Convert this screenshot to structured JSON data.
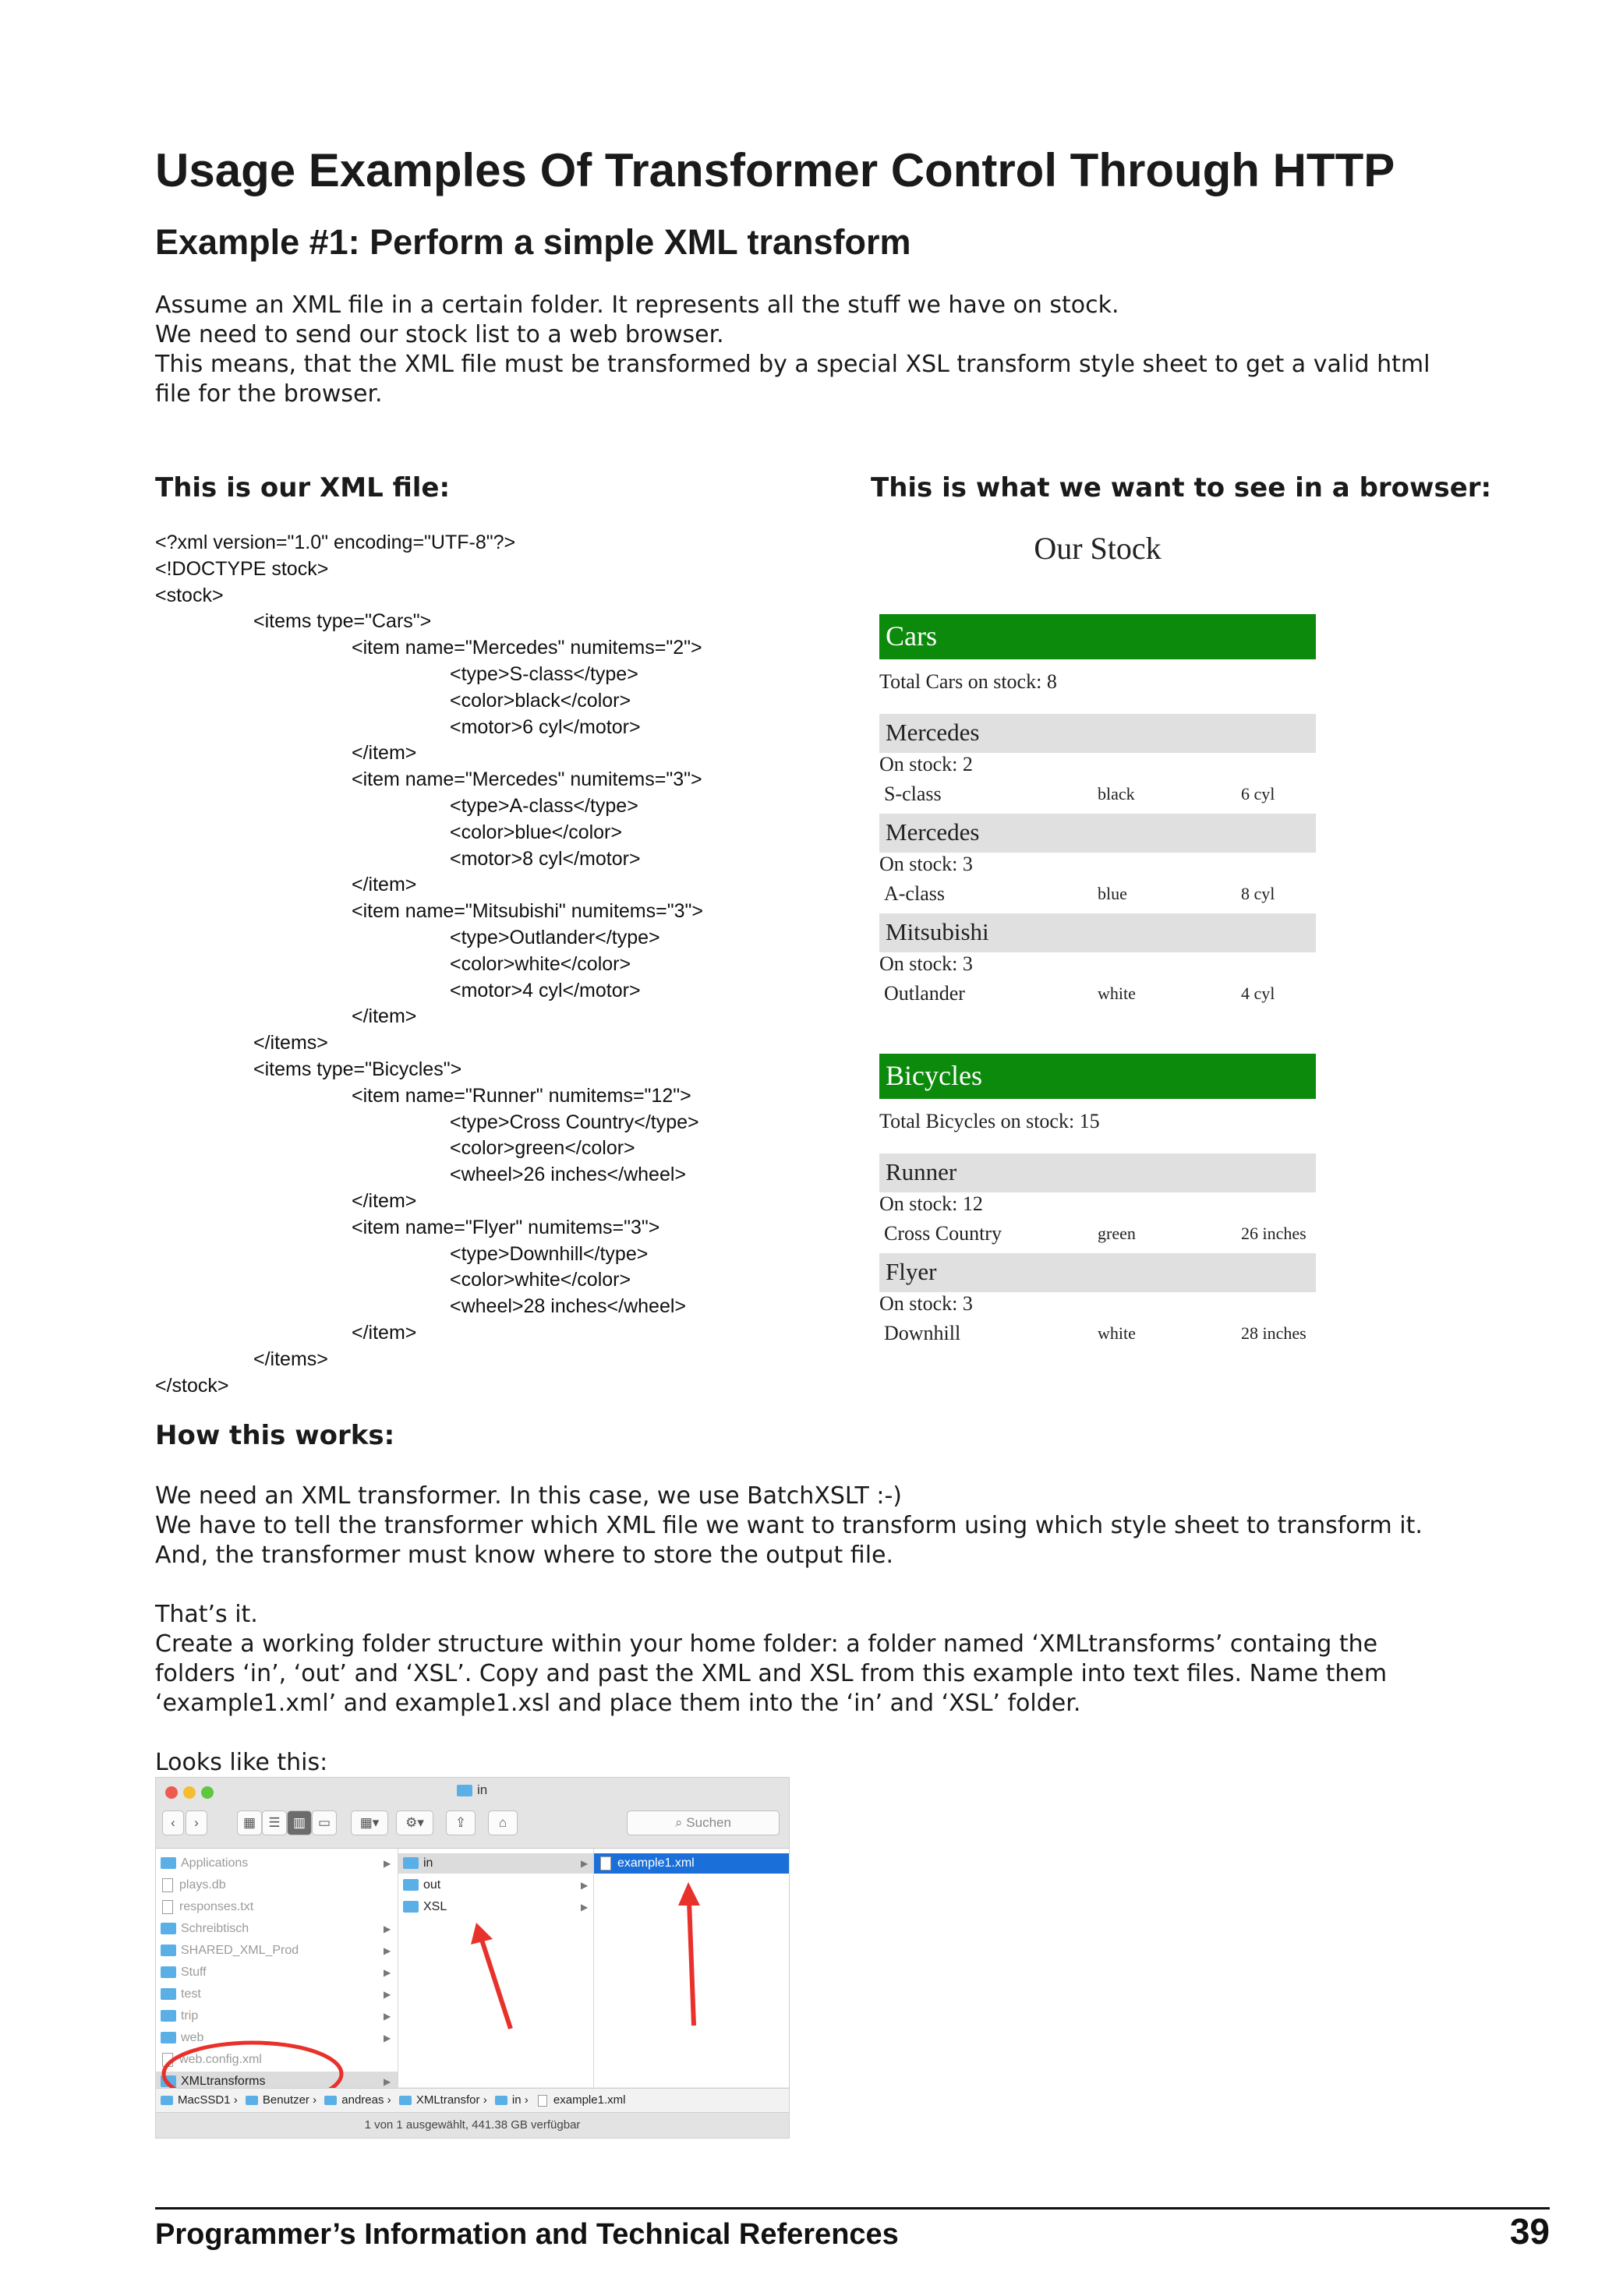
{
  "title": "Usage Examples Of Transformer Control Through HTTP",
  "example_heading": "Example #1: Perform a simple XML transform",
  "intro": [
    "Assume an XML file in a certain folder. It represents all the stuff we have on stock.",
    "We need to send our stock list to a web browser.",
    "This means, that the XML file must be transformed by a special XSL transform style sheet to get a valid html",
    "file for the browser."
  ],
  "xml_heading": "This is our XML file:",
  "browser_heading": "This is what we want to see in a browser:",
  "xml_lines": [
    "<?xml version=\"1.0\" encoding=\"UTF-8\"?>",
    "<!DOCTYPE stock>",
    "<stock>",
    "\t<items type=\"Cars\">",
    "\t\t<item name=\"Mercedes\" numitems=\"2\">",
    "\t\t\t<type>S-class</type>",
    "\t\t\t<color>black</color>",
    "\t\t\t<motor>6 cyl</motor>",
    "\t\t</item>",
    "\t\t<item name=\"Mercedes\" numitems=\"3\">",
    "\t\t\t<type>A-class</type>",
    "\t\t\t<color>blue</color>",
    "\t\t\t<motor>8 cyl</motor>",
    "\t\t</item>",
    "\t\t<item name=\"Mitsubishi\" numitems=\"3\">",
    "\t\t\t<type>Outlander</type>",
    "\t\t\t<color>white</color>",
    "\t\t\t<motor>4 cyl</motor>",
    "\t\t</item>",
    "\t</items>",
    "\t<items type=\"Bicycles\">",
    "\t\t<item name=\"Runner\" numitems=\"12\">",
    "\t\t\t<type>Cross Country</type>",
    "\t\t\t<color>green</color>",
    "\t\t\t<wheel>26 inches</wheel>",
    "\t\t</item>",
    "\t\t<item name=\"Flyer\" numitems=\"3\">",
    "\t\t\t<type>Downhill</type>",
    "\t\t\t<color>white</color>",
    "\t\t\t<wheel>28 inches</wheel>",
    "\t\t</item>",
    "\t</items>",
    "</stock>"
  ],
  "stock_view": {
    "title": "Our Stock",
    "accent_color": "#0b8a0b",
    "categories": [
      {
        "name": "Cars",
        "total": "Total Cars on stock: 8",
        "items": [
          {
            "name": "Mercedes",
            "onstock": "On stock: 2",
            "type": "S-class",
            "color": "black",
            "spec": "6 cyl"
          },
          {
            "name": "Mercedes",
            "onstock": "On stock: 3",
            "type": "A-class",
            "color": "blue",
            "spec": "8 cyl"
          },
          {
            "name": "Mitsubishi",
            "onstock": "On stock: 3",
            "type": "Outlander",
            "color": "white",
            "spec": "4 cyl"
          }
        ]
      },
      {
        "name": "Bicycles",
        "total": "Total Bicycles on stock: 15",
        "items": [
          {
            "name": "Runner",
            "onstock": "On stock: 12",
            "type": "Cross Country",
            "color": "green",
            "spec": "26 inches"
          },
          {
            "name": "Flyer",
            "onstock": "On stock: 3",
            "type": "Downhill",
            "color": "white",
            "spec": "28 inches"
          }
        ]
      }
    ]
  },
  "how_heading": "How this works:",
  "how_lines": [
    "We need an XML transformer. In this case, we use BatchXSLT :-)",
    "We have to tell the transformer which XML file we want to transform using which style sheet to transform it.",
    "And, the transformer must know where to store the output file."
  ],
  "thats_it": "That’s it.",
  "create_lines": [
    "Create a working folder structure within your home folder: a folder named ‘XMLtransforms’ containg the",
    "folders ‘in’, ‘out’ and ‘XSL’. Copy and past the XML and XSL from this example into text files. Name them",
    "‘example1.xml’ and example1.xsl and place them into the ‘in’ and ‘XSL’ folder."
  ],
  "looks_like": "Looks like this:",
  "finder": {
    "window_title": "in",
    "search_placeholder": "Suchen",
    "sidebar_items": [
      "Applications",
      "plays.db",
      "responses.txt",
      "Schreibtisch",
      "SHARED_XML_Prod",
      "Stuff",
      "test",
      "trip",
      "web",
      "web.config.xml",
      "XMLtransforms"
    ],
    "folders": [
      "in",
      "out",
      "XSL"
    ],
    "files": [
      "example1.xml"
    ],
    "path": [
      "MacSSD1",
      "Benutzer",
      "andreas",
      "XMLtransfor",
      "in",
      "example1.xml"
    ],
    "status": "1 von 1 ausgewählt, 441.38 GB verfügbar"
  },
  "footer": "Programmer’s Information and Technical References",
  "page_number": "39"
}
